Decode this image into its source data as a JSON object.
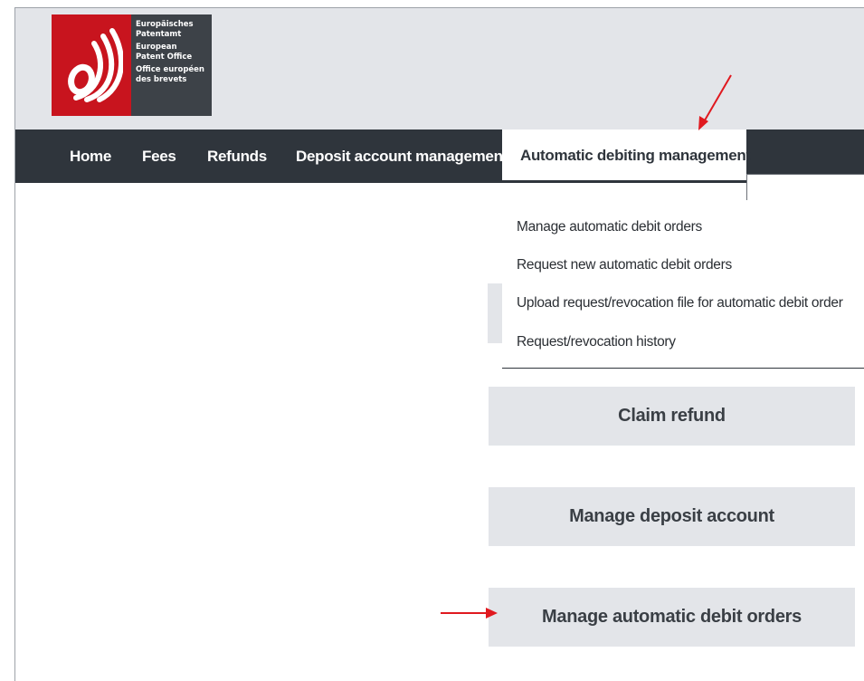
{
  "logo": {
    "lines": [
      "Europäisches",
      "Patentamt",
      "European",
      "Patent Office",
      "Office européen",
      "des brevets"
    ],
    "brand_color": "#c8141e"
  },
  "nav": {
    "items": [
      "Home",
      "Fees",
      "Refunds",
      "Deposit account management"
    ],
    "active": "Automatic debiting management"
  },
  "dropdown": {
    "items": [
      "Manage automatic debit orders",
      "Request new automatic debit orders",
      "Upload request/revocation file for automatic debit order",
      "Request/revocation history"
    ]
  },
  "actions": [
    "Claim refund",
    "Manage deposit account",
    "Manage automatic debit orders"
  ],
  "colors": {
    "navbar": "#2f353c",
    "header": "#e3e5e9",
    "annotation_arrow": "#e0191f"
  }
}
